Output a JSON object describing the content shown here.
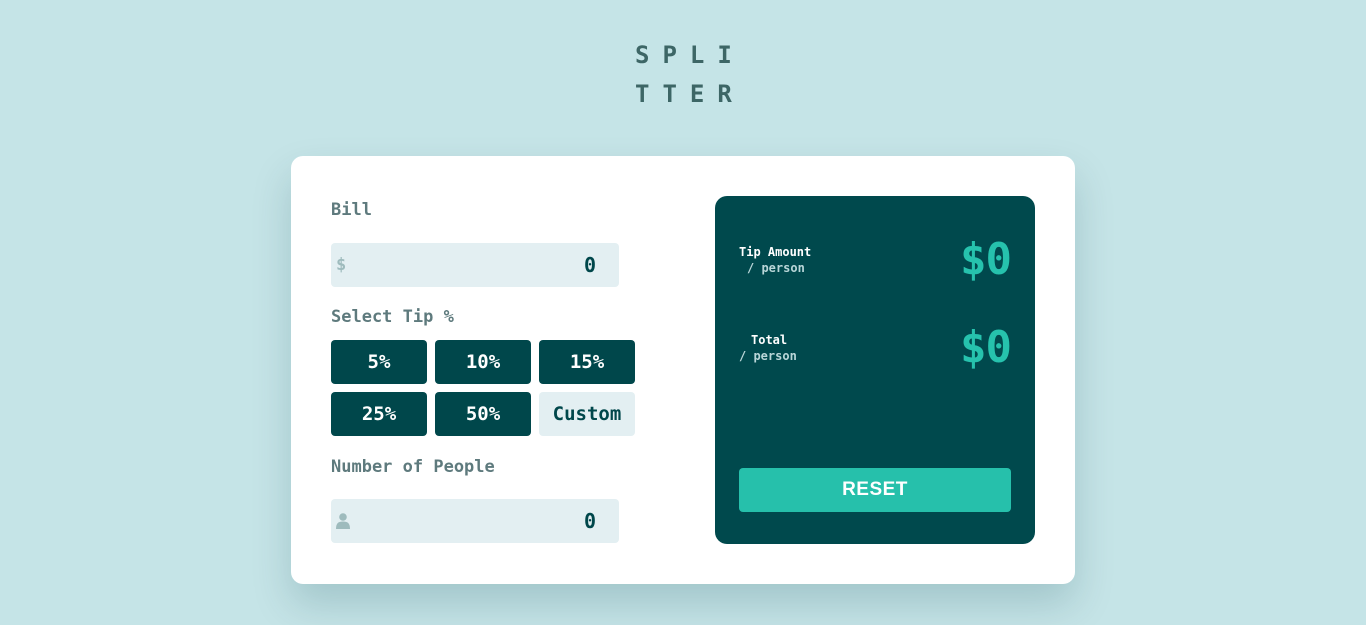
{
  "logo": {
    "line1": "SPLI",
    "line2": "TTER"
  },
  "form": {
    "bill_label": "Bill",
    "bill_prefix": "$",
    "bill_value": "0",
    "tip_label": "Select Tip %",
    "tips": [
      "5%",
      "10%",
      "15%",
      "25%",
      "50%"
    ],
    "custom_label": "Custom",
    "people_label": "Number of People",
    "people_icon": "person-icon",
    "people_value": "0"
  },
  "results": {
    "tip_amount_label": "Tip Amount",
    "tip_amount_sub": "/ person",
    "tip_amount_value": "$0",
    "total_label": "Total",
    "total_sub": "/ person",
    "total_value": "$0",
    "reset_label": "RESET"
  },
  "colors": {
    "background": "#c5e4e7",
    "dark_cyan": "#00474b",
    "accent": "#26c2ad",
    "input_bg": "#e3eff2"
  }
}
